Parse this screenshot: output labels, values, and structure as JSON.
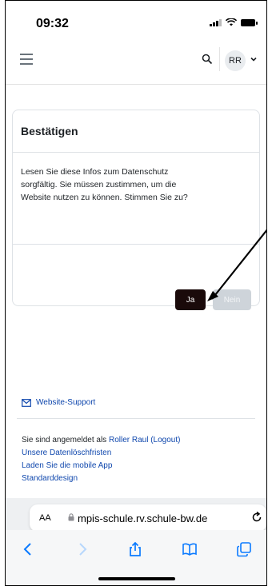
{
  "status_bar": {
    "time": "09:32"
  },
  "navbar": {
    "avatar_initials": "RR"
  },
  "modal": {
    "title": "Bestätigen",
    "body_lines": [
      "Lesen Sie diese Infos zum Datenschutz",
      "sorgfältig. Sie müssen zustimmen, um die",
      "Website nutzen zu können. Stimmen Sie zu?"
    ],
    "yes_label": "Ja",
    "no_label": "Nein"
  },
  "footer": {
    "support_label": "Website-Support",
    "logged_in_prefix": "Sie sind angemeldet als ",
    "user_name": "Roller Raul",
    "logout_label": "(Logout)",
    "links": [
      "Unsere Datenlöschfristen",
      "Laden Sie die mobile App",
      "Standarddesign"
    ]
  },
  "browser": {
    "aa_label": "AA",
    "url": "mpis-schule.rv.schule-bw.de"
  },
  "colors": {
    "accent": "#0f47ad",
    "primary_button": "#1a0a0a",
    "secondary_button": "#ced4da"
  },
  "icons": [
    "menu-icon",
    "search-icon",
    "chevron-down-icon",
    "envelope-icon",
    "lock-icon",
    "reload-icon",
    "back-icon",
    "forward-icon",
    "share-icon",
    "bookmarks-icon",
    "tabs-icon"
  ]
}
